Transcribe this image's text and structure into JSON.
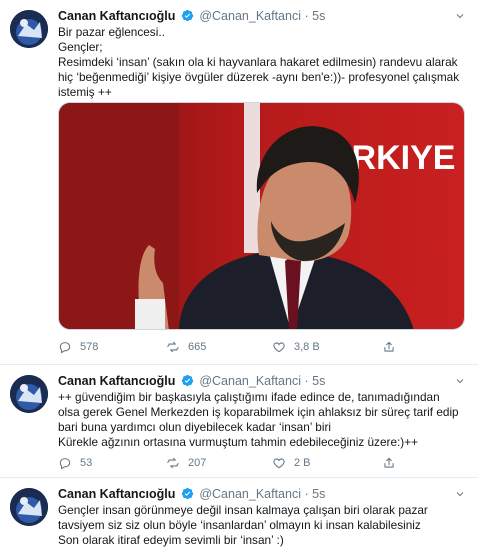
{
  "tweets": [
    {
      "name": "Canan Kaftancıoğlu",
      "handle": "@Canan_Kaftanci",
      "separator": "·",
      "time": "5s",
      "lines": [
        "Bir pazar eğlencesi..",
        "Gençler;",
        "Resimdeki ‘insan’ (sakın ola ki hayvanlara hakaret edilmesin) randevu alarak",
        "hiç ‘beğenmediği’ kişiye övgüler düzerek -aynı ben'e:))- profesyonel çalışmak",
        "istemiş ++"
      ],
      "media_text": "ÜRKIYE",
      "stats": {
        "replies": "578",
        "retweets": "665",
        "likes": "3,8 B"
      }
    },
    {
      "name": "Canan Kaftancıoğlu",
      "handle": "@Canan_Kaftanci",
      "separator": "·",
      "time": "5s",
      "lines": [
        "++ güvendiğim bir başkasıyla çalıştığımı ifade edince de, tanımadığından",
        "olsa gerek Genel Merkezden iş koparabilmek için  ahlaksız bir süreç tarif edip",
        "bari buna yardımcı olun diyebilecek kadar ‘insan’ biri",
        "Kürekle ağzının ortasına vurmuştum tahmin edebileceğiniz üzere:)++"
      ],
      "stats": {
        "replies": "53",
        "retweets": "207",
        "likes": "2 B"
      }
    },
    {
      "name": "Canan Kaftancıoğlu",
      "handle": "@Canan_Kaftanci",
      "separator": "·",
      "time": "5s",
      "lines": [
        "Gençler insan görünmeye değil insan kalmaya çalışan biri olarak pazar",
        "tavsiyem siz siz olun böyle ‘insanlardan’ olmayın ki insan kalabilesiniz",
        "Son olarak itiraf edeyim sevimli bir ‘insan’ :)"
      ]
    }
  ],
  "colors": {
    "verified": "#1da1f2",
    "secondary": "#657786",
    "divider": "#e6ecf0"
  }
}
